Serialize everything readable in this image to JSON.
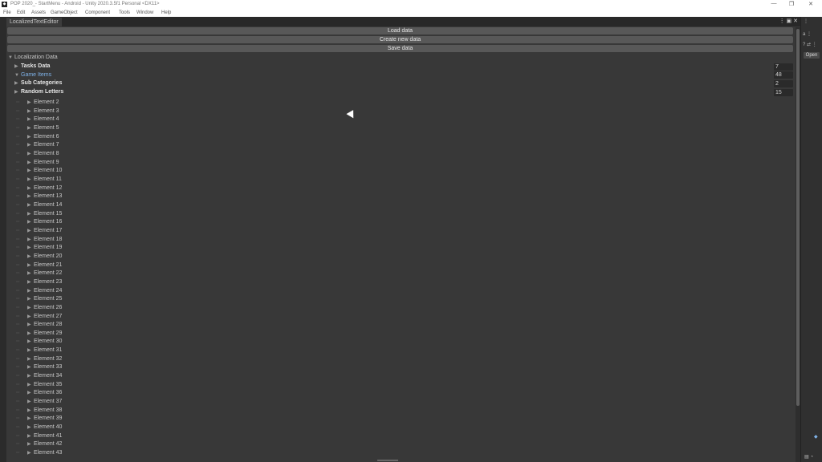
{
  "window": {
    "title": "POP 2020_- StartMenu - Android - Unity 2020.3.5f1 Personal <DX11>",
    "app_icon": "unity-icon",
    "buttons": [
      "—",
      "❐",
      "✕"
    ]
  },
  "menubar": [
    "File",
    "Edit",
    "Assets",
    "GameObject",
    "Component",
    "Tools",
    "Window",
    "Help"
  ],
  "editor": {
    "tab_label": "LocalizedTextEditor",
    "buttons": {
      "load": "Load data",
      "create": "Create new data",
      "save": "Save data"
    },
    "tree": {
      "root_label": "Localization Data",
      "groups": [
        {
          "label": "Tasks Data",
          "count": "7",
          "expanded": false,
          "highlight": false
        },
        {
          "label": "Game Items",
          "count": "48",
          "expanded": true,
          "highlight": true
        },
        {
          "label": "Sub Categories",
          "count": "2",
          "expanded": false,
          "highlight": false
        },
        {
          "label": "Random Letters",
          "count": "15",
          "expanded": false,
          "highlight": false
        }
      ],
      "elements": [
        "Element 2",
        "Element 3",
        "Element 4",
        "Element 5",
        "Element 6",
        "Element 7",
        "Element 8",
        "Element 9",
        "Element 10",
        "Element 11",
        "Element 12",
        "Element 13",
        "Element 14",
        "Element 15",
        "Element 16",
        "Element 17",
        "Element 18",
        "Element 19",
        "Element 20",
        "Element 21",
        "Element 22",
        "Element 23",
        "Element 24",
        "Element 25",
        "Element 26",
        "Element 27",
        "Element 28",
        "Element 29",
        "Element 30",
        "Element 31",
        "Element 32",
        "Element 33",
        "Element 34",
        "Element 35",
        "Element 36",
        "Element 37",
        "Element 38",
        "Element 39",
        "Element 40",
        "Element 41",
        "Element 42",
        "Element 43"
      ]
    }
  },
  "right_panel": {
    "open_label": "Open"
  },
  "colors": {
    "highlight_text": "#7fb2e8",
    "background": "#383838"
  }
}
